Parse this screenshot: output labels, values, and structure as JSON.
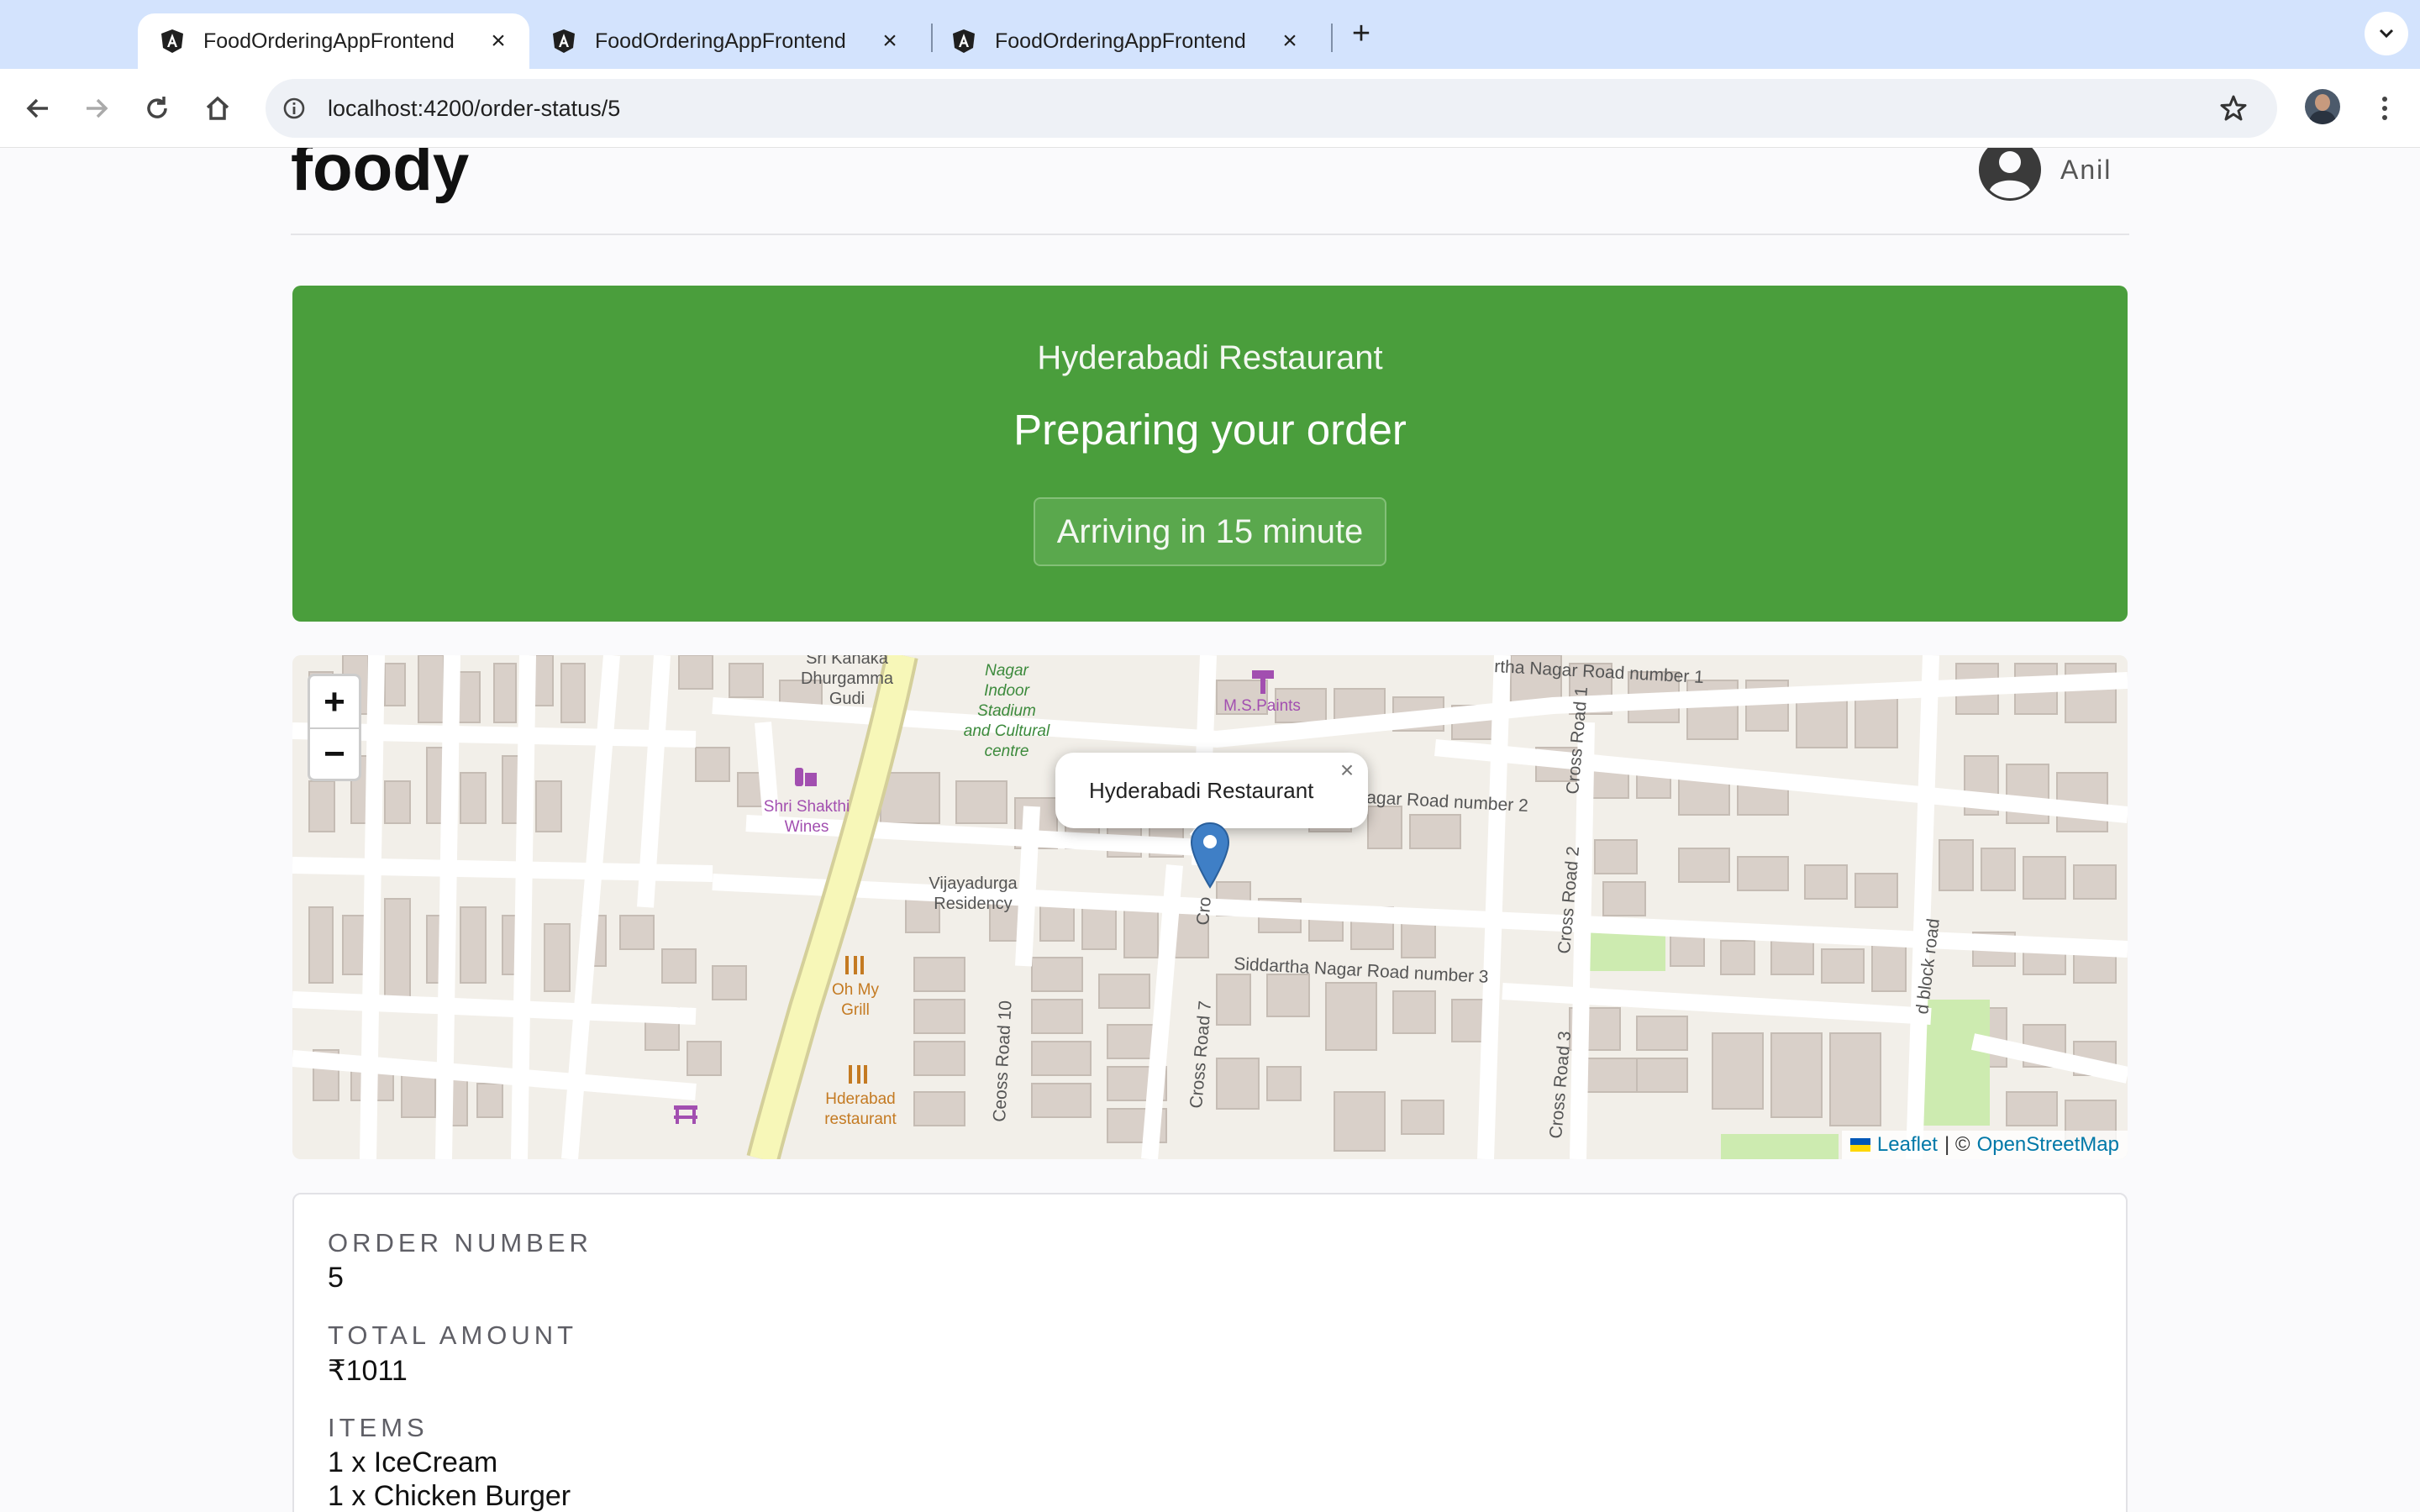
{
  "browser": {
    "tabs": [
      {
        "title": "FoodOrderingAppFrontend",
        "active": true
      },
      {
        "title": "FoodOrderingAppFrontend",
        "active": false
      },
      {
        "title": "FoodOrderingAppFrontend",
        "active": false
      }
    ],
    "url": "localhost:4200/order-status/5"
  },
  "header": {
    "brand": "foody",
    "username": "Anil"
  },
  "status": {
    "restaurant": "Hyderabadi Restaurant",
    "message": "Preparing your order",
    "eta": "Arriving in 15 minute",
    "color": "#4a9e3c"
  },
  "map": {
    "zoom_in": "+",
    "zoom_out": "−",
    "popup": "Hyderabadi Restaurant",
    "popup_close": "×",
    "attribution_leaflet": "Leaflet",
    "attribution_separator": "| ©",
    "attribution_osm": "OpenStreetMap",
    "labels": {
      "road_number_1": "rtha Nagar Road number 1",
      "road_number_2": "agar Road number 2",
      "road_number_3": "Siddartha Nagar Road number 3",
      "cross_road_1": "Cross Road 1",
      "cross_road_2": "Cross Road 2",
      "cross_road_3": "Cross Road 3",
      "cross_road_7": "Cross Road 7",
      "cross_road_10": "Ceoss Road 10",
      "block_road": "d block road",
      "cross_fragment": "Cro",
      "dhurgamma_1": "Sri Kanaka",
      "dhurgamma_2": "Dhurgamma",
      "dhurgamma_3": "Gudi",
      "stadium_1": "Nagar",
      "stadium_2": "Indoor",
      "stadium_3": "Stadium",
      "stadium_4": "and Cultural",
      "stadium_5": "centre",
      "paints": "M.S.Paints",
      "wines_1": "Shri Shakthi",
      "wines_2": "Wines",
      "residency_1": "Vijayadurga",
      "residency_2": "Residency",
      "grill_1": "Oh My",
      "grill_2": "Grill",
      "hderabad_1": "Hderabad",
      "hderabad_2": "restaurant"
    }
  },
  "order": {
    "number_label": "ORDER NUMBER",
    "number": "5",
    "total_label": "TOTAL AMOUNT",
    "total": "₹1011",
    "items_label": "ITEMS",
    "items": [
      "1 x IceCream",
      "1 x Chicken Burger"
    ]
  }
}
